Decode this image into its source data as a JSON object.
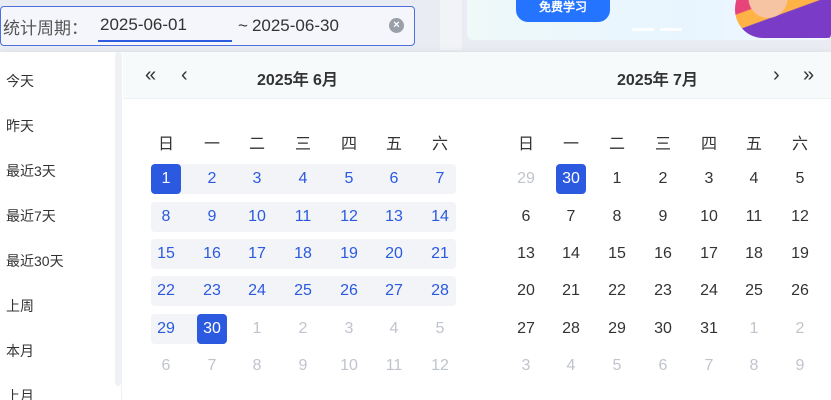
{
  "filter": {
    "label": "统计周期：",
    "start": "2025-06-01",
    "separator": "~",
    "end": "2025-06-30",
    "clear_icon": "×"
  },
  "banner": {
    "button": "免费学习"
  },
  "shortcuts": [
    "今天",
    "昨天",
    "最近3天",
    "最近7天",
    "最近30天",
    "上周",
    "本月",
    "上月"
  ],
  "nav": {
    "prev_year": "«",
    "prev_month": "‹",
    "next_month": "›",
    "next_year": "»"
  },
  "weekdays": [
    "日",
    "一",
    "二",
    "三",
    "四",
    "五",
    "六"
  ],
  "left": {
    "title": "2025年 6月",
    "days": [
      [
        "1",
        "2",
        "3",
        "4",
        "5",
        "6",
        "7"
      ],
      [
        "8",
        "9",
        "10",
        "11",
        "12",
        "13",
        "14"
      ],
      [
        "15",
        "16",
        "17",
        "18",
        "19",
        "20",
        "21"
      ],
      [
        "22",
        "23",
        "24",
        "25",
        "26",
        "27",
        "28"
      ],
      [
        "29",
        "30",
        "1",
        "2",
        "3",
        "4",
        "5"
      ],
      [
        "6",
        "7",
        "8",
        "9",
        "10",
        "11",
        "12"
      ]
    ]
  },
  "right": {
    "title": "2025年 7月",
    "days": [
      [
        "29",
        "30",
        "1",
        "2",
        "3",
        "4",
        "5"
      ],
      [
        "6",
        "7",
        "8",
        "9",
        "10",
        "11",
        "12"
      ],
      [
        "13",
        "14",
        "15",
        "16",
        "17",
        "18",
        "19"
      ],
      [
        "20",
        "21",
        "22",
        "23",
        "24",
        "25",
        "26"
      ],
      [
        "27",
        "28",
        "29",
        "30",
        "31",
        "1",
        "2"
      ],
      [
        "3",
        "4",
        "5",
        "6",
        "7",
        "8",
        "9"
      ]
    ]
  },
  "colors": {
    "accent": "#2b59e0",
    "muted": "#c0c4cc",
    "range_bg": "#f2f4f8"
  }
}
